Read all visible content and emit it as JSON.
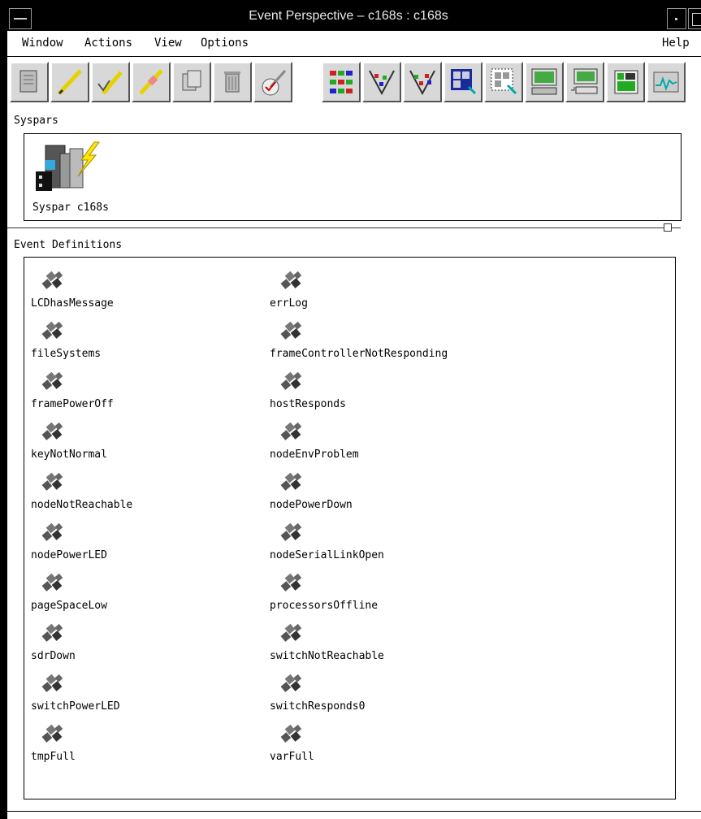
{
  "window": {
    "title": "Event Perspective – c168s : c168s"
  },
  "menubar": {
    "items": [
      "Window",
      "Actions",
      "View",
      "Options"
    ],
    "help": "Help"
  },
  "toolbar": {
    "buttons": [
      {
        "icon": "notebook-icon"
      },
      {
        "icon": "pencil-icon"
      },
      {
        "icon": "check-pencil-icon"
      },
      {
        "icon": "eraser-pencil-icon"
      },
      {
        "icon": "copy-icon"
      },
      {
        "icon": "trash-icon"
      },
      {
        "icon": "register-icon"
      },
      {
        "icon": "icon-view-icon"
      },
      {
        "icon": "filter-icon"
      },
      {
        "icon": "filter-select-icon"
      },
      {
        "icon": "pane-select-icon"
      },
      {
        "icon": "pane-dotted-icon"
      },
      {
        "icon": "monitor-icon"
      },
      {
        "icon": "monitor-keyboard-icon"
      },
      {
        "icon": "table-view-icon"
      },
      {
        "icon": "graph-icon"
      }
    ]
  },
  "syspars": {
    "label": "Syspars",
    "item": "Syspar c168s"
  },
  "events": {
    "label": "Event Definitions",
    "left": [
      "LCDhasMessage",
      "fileSystems",
      "framePowerOff",
      "keyNotNormal",
      "nodeNotReachable",
      "nodePowerLED",
      "pageSpaceLow",
      "sdrDown",
      "switchPowerLED",
      "tmpFull"
    ],
    "right": [
      "errLog",
      "frameControllerNotResponding",
      "hostResponds",
      "nodeEnvProblem",
      "nodePowerDown",
      "nodeSerialLinkOpen",
      "processorsOffline",
      "switchNotReachable",
      "switchResponds0",
      "varFull"
    ]
  }
}
